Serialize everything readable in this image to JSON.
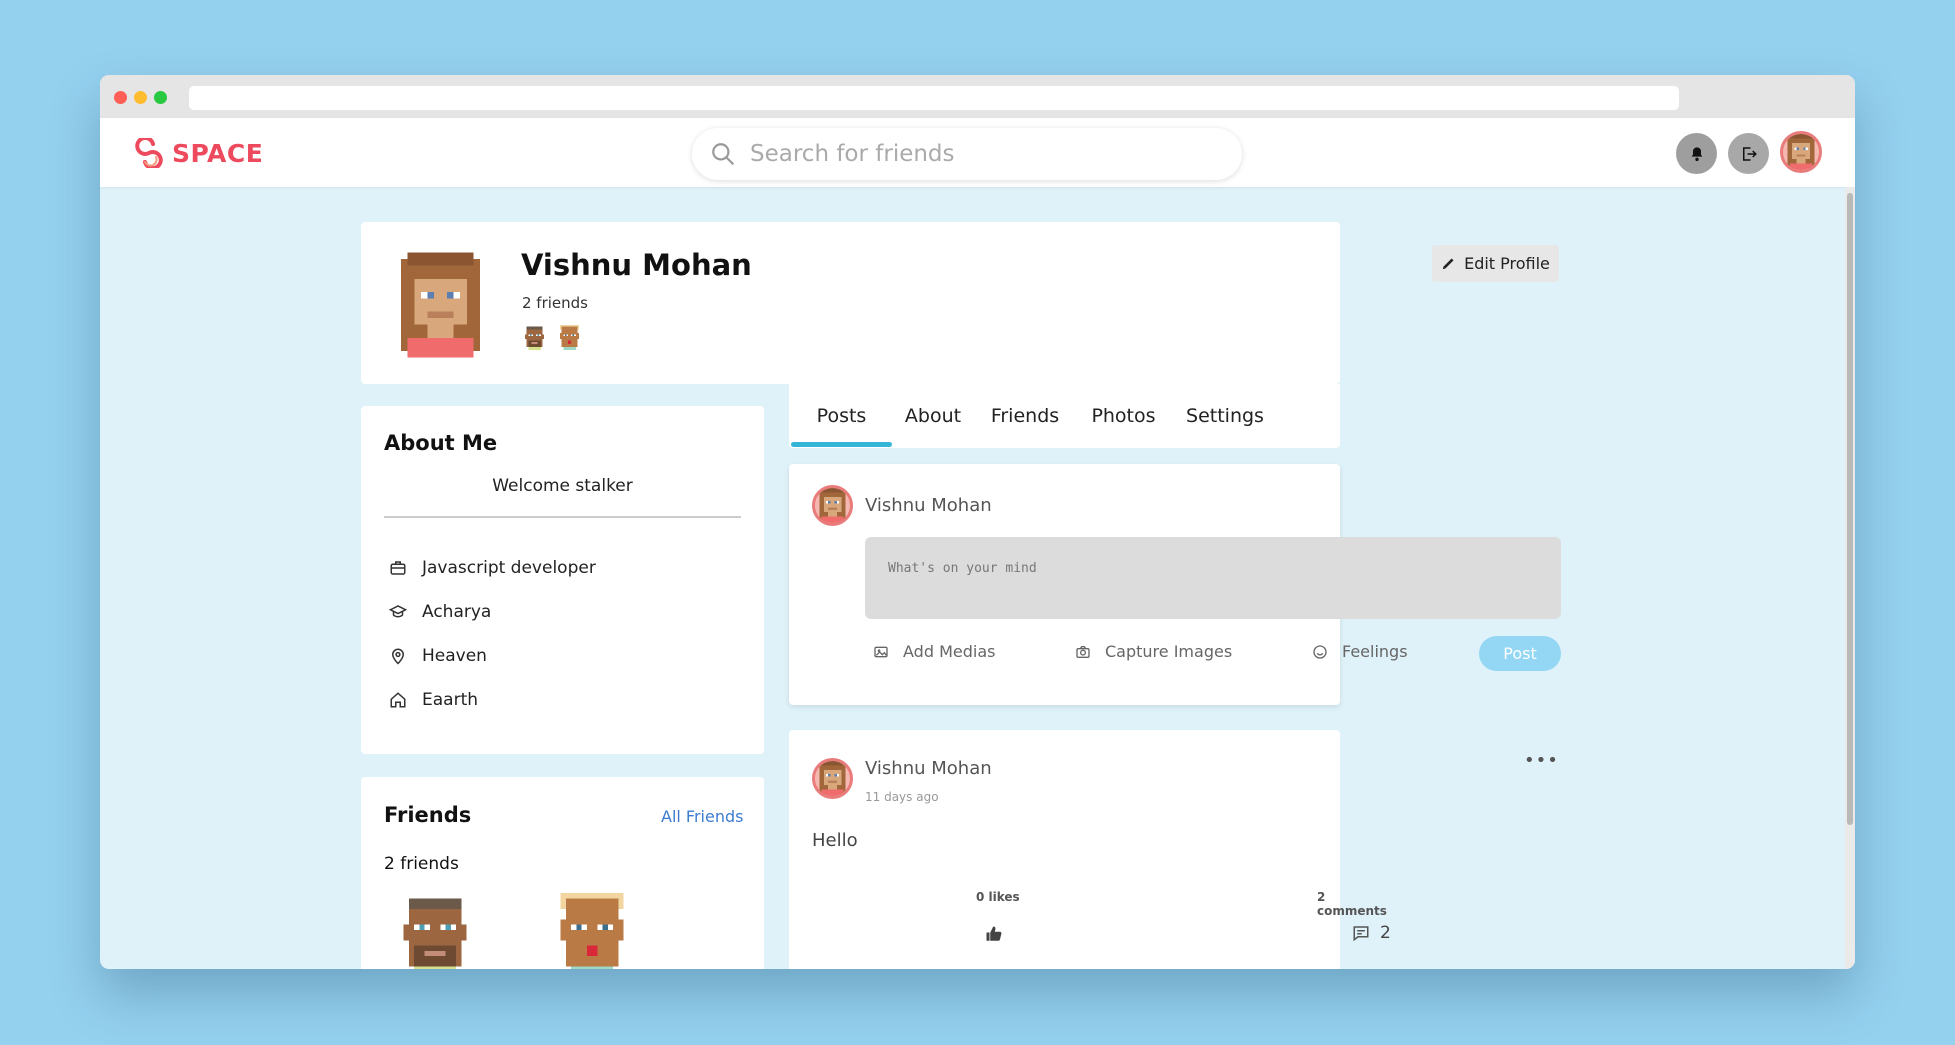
{
  "brand": {
    "name": "SPACE",
    "color": "#ee4a5e"
  },
  "search": {
    "placeholder": "Search for friends"
  },
  "icons": {
    "bell": "bell-icon",
    "logout": "logout-icon"
  },
  "profile": {
    "name": "Vishnu Mohan",
    "friends_count": "2 friends",
    "edit_label": "Edit Profile"
  },
  "about": {
    "title": "About Me",
    "bio": "Welcome stalker",
    "items": [
      {
        "icon": "briefcase-icon",
        "text": "Javascript developer"
      },
      {
        "icon": "graduation-cap-icon",
        "text": "Acharya"
      },
      {
        "icon": "location-pin-icon",
        "text": "Heaven"
      },
      {
        "icon": "home-icon",
        "text": "Eaarth"
      }
    ]
  },
  "friends_card": {
    "title": "Friends",
    "all_link": "All Friends",
    "count": "2 friends"
  },
  "tabs": [
    "Posts",
    "About",
    "Friends",
    "Photos",
    "Settings"
  ],
  "active_tab": "Posts",
  "composer": {
    "user": "Vishnu Mohan",
    "placeholder": "What's on your mind",
    "actions": {
      "media": "Add Medias",
      "capture": "Capture Images",
      "feelings": "Feelings"
    },
    "post_label": "Post"
  },
  "post": {
    "user": "Vishnu Mohan",
    "time": "11 days ago",
    "text": "Hello",
    "likes": "0 likes",
    "comments": "2 comments",
    "comment_count": "2"
  },
  "colors": {
    "accent": "#35b6d8",
    "post_button": "#93d7f4",
    "link": "#3d7dd1",
    "background": "#94d1ef"
  }
}
